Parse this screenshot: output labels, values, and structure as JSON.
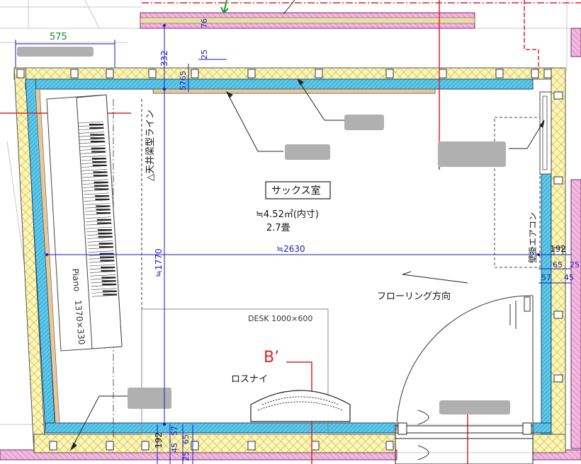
{
  "room": {
    "name": "サックス室",
    "area": "≒4.52㎡(内寸)",
    "tatami": "2.7畳"
  },
  "dimensions": {
    "top_left_width": "575",
    "top_vertical": "332",
    "top_wall_thickness": "25",
    "top_small": "5765",
    "top_outer_strip": "76",
    "width_inner": "≒2630",
    "height_inner": "≒1770",
    "right_192": "192",
    "right_65": "65",
    "right_25": "25",
    "right_57": "57",
    "right_45": "45",
    "bottom_192": "192",
    "bottom_57": "57",
    "bottom_45": "45",
    "bottom_65": "65",
    "bottom_25": "25"
  },
  "labels": {
    "ceiling_beam": "△天井梁型ライン",
    "aircon": "壁掛エアコン",
    "flooring": "フローリング方向",
    "desk": "DESK 1000×600",
    "losnay": "ロスナイ",
    "piano": "Piano　1370×330",
    "section_mark": "B’"
  },
  "colors": {
    "wall_insulation": "#fdf6b8",
    "wall_inner_layer": "#5bc8ea",
    "dimension": "#1a1ab8",
    "section_line": "#d9232e",
    "grid_line": "#c8c8c8",
    "magenta_strip": "#f2b8e0"
  }
}
